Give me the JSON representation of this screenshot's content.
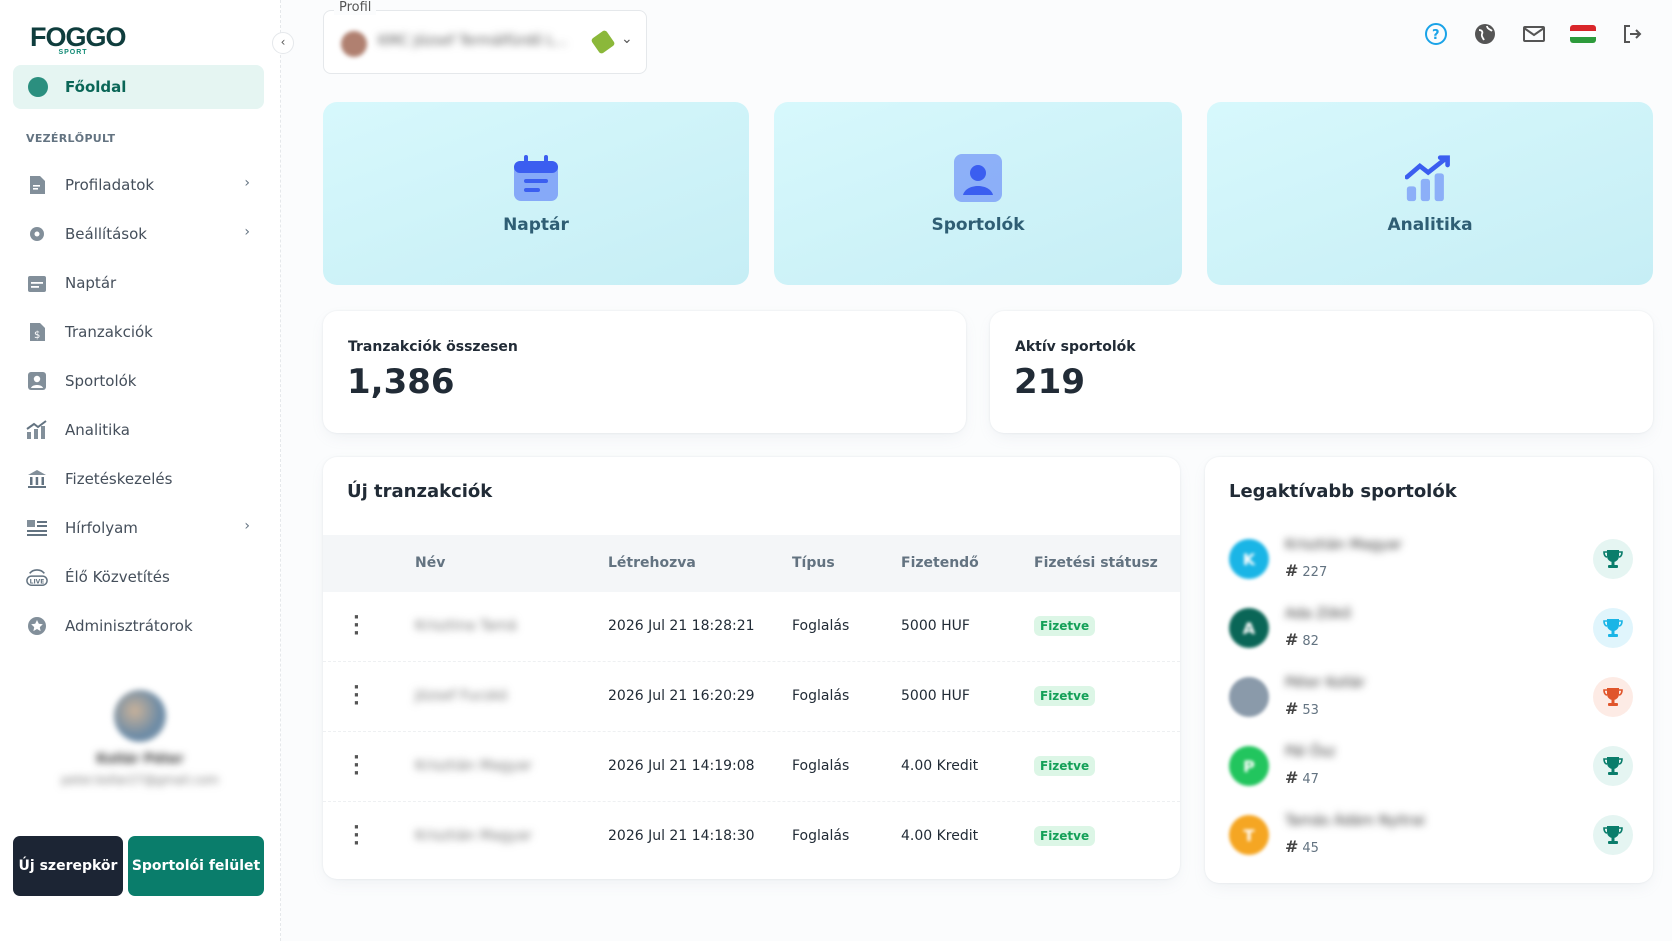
{
  "sidebar": {
    "logo_text": "FOGGO",
    "logo_sub": "SPORT",
    "home_label": "Főoldal",
    "section_label": "VEZÉRLŐPULT",
    "items": [
      {
        "label": "Profiladatok",
        "icon": "document-icon",
        "has_chevron": true
      },
      {
        "label": "Beállítások",
        "icon": "gear-icon",
        "has_chevron": true
      },
      {
        "label": "Naptár",
        "icon": "calendar-icon",
        "has_chevron": false
      },
      {
        "label": "Tranzakciók",
        "icon": "dollar-document-icon",
        "has_chevron": false
      },
      {
        "label": "Sportolók",
        "icon": "user-icon",
        "has_chevron": false
      },
      {
        "label": "Analitika",
        "icon": "chart-icon",
        "has_chevron": false
      },
      {
        "label": "Fizetéskezelés",
        "icon": "bank-icon",
        "has_chevron": false
      },
      {
        "label": "Hírfolyam",
        "icon": "news-icon",
        "has_chevron": true
      },
      {
        "label": "Élő Közvetítés",
        "icon": "live-icon",
        "has_chevron": false
      },
      {
        "label": "Adminisztrátorok",
        "icon": "star-badge-icon",
        "has_chevron": false
      }
    ],
    "user_name": "Kollár Péter",
    "user_email": "peter.kollar27@gmail.com",
    "btn_new_role": "Új szerepkör",
    "btn_athlete_ui": "Sportolói felület"
  },
  "header": {
    "profile_label": "Profil",
    "profile_name": "KMC József Termálfürdő L...",
    "icons": [
      "help-icon",
      "globe-icon",
      "mail-icon",
      "flag-hu-icon",
      "logout-icon"
    ]
  },
  "tiles": [
    {
      "label": "Naptár",
      "icon": "calendar-icon"
    },
    {
      "label": "Sportolók",
      "icon": "user-icon"
    },
    {
      "label": "Analitika",
      "icon": "chart-icon"
    }
  ],
  "stats": {
    "transactions_label": "Tranzakciók összesen",
    "transactions_value": "1,386",
    "athletes_label": "Aktív sportolók",
    "athletes_value": "219"
  },
  "transactions": {
    "title": "Új tranzakciók",
    "columns": [
      "Név",
      "Létrehozva",
      "Típus",
      "Fizetendő",
      "Fizetési státusz"
    ],
    "rows": [
      {
        "name": "Krisztina Tamá",
        "created": "2026 Jul 21 18:28:21",
        "type": "Foglalás",
        "amount": "5000 HUF",
        "status": "Fizetve"
      },
      {
        "name": "József Fucskó",
        "created": "2026 Jul 21 16:20:29",
        "type": "Foglalás",
        "amount": "5000 HUF",
        "status": "Fizetve"
      },
      {
        "name": "Krisztián Magyar",
        "created": "2026 Jul 21 14:19:08",
        "type": "Foglalás",
        "amount": "4.00 Kredit",
        "status": "Fizetve"
      },
      {
        "name": "Krisztián Magyar",
        "created": "2026 Jul 21 14:18:30",
        "type": "Foglalás",
        "amount": "4.00 Kredit",
        "status": "Fizetve"
      }
    ]
  },
  "leaderboard": {
    "title": "Legaktívabb sportolók",
    "items": [
      {
        "initial": "K",
        "name": "Krisztián Magyar",
        "rank": "227",
        "color": "#1ab5e6",
        "trophy_color": "#0a7d6b",
        "trophy_bg": "#e5f5f2"
      },
      {
        "initial": "A",
        "name": "Ada Zökő",
        "rank": "82",
        "color": "#0a6657",
        "trophy_color": "#1ab5e6",
        "trophy_bg": "#e0f5fc"
      },
      {
        "initial": "",
        "name": "Péter Kollár",
        "rank": "53",
        "color": "#8a9aaa",
        "trophy_color": "#e0552b",
        "trophy_bg": "#fdebe5"
      },
      {
        "initial": "P",
        "name": "Pál Ősz",
        "rank": "47",
        "color": "#22c55e",
        "trophy_color": "#0a7d6b",
        "trophy_bg": "#e5f5f2"
      },
      {
        "initial": "T",
        "name": "Tamás Ádám Nyitrai",
        "rank": "45",
        "color": "#f5a623",
        "trophy_color": "#0a7d6b",
        "trophy_bg": "#e5f5f2"
      }
    ]
  }
}
